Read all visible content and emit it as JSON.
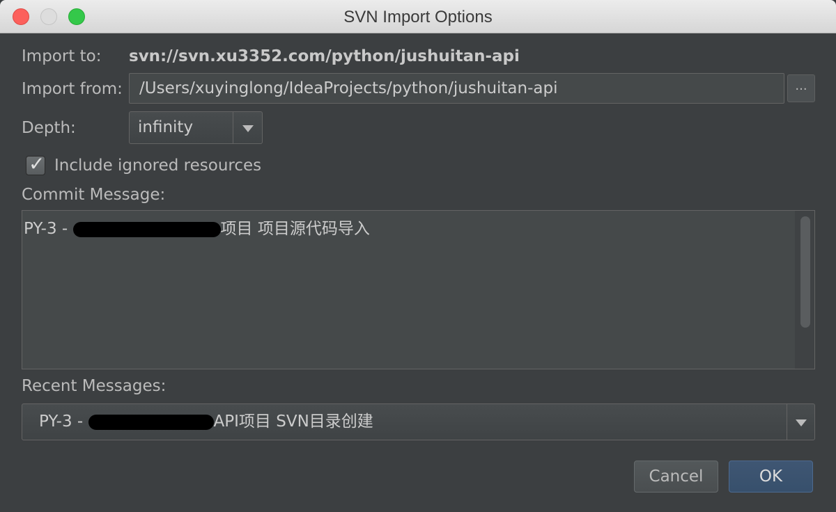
{
  "window": {
    "title": "SVN Import Options"
  },
  "import_to": {
    "label": "Import to:",
    "value": "svn://svn.xu3352.com/python/jushuitan-api"
  },
  "import_from": {
    "label": "Import from:",
    "value": "/Users/xuyinglong/IdeaProjects/python/jushuitan-api",
    "browse_label": "..."
  },
  "depth": {
    "label": "Depth:",
    "selected": "infinity"
  },
  "include_ignored": {
    "label": "Include ignored resources",
    "checked": true
  },
  "commit_message": {
    "label": "Commit Message:",
    "value_prefix": "PY-3 - ",
    "value_suffix": "项目 项目源代码导入"
  },
  "recent_messages": {
    "label": "Recent Messages:",
    "selected_prefix": "PY-3 - ",
    "selected_suffix": "API项目 SVN目录创建"
  },
  "buttons": {
    "cancel": "Cancel",
    "ok": "OK"
  },
  "colors": {
    "background": "#3c3f41",
    "ok_button": "#3f5673",
    "close": "#fc605c",
    "maximize": "#34c84a"
  }
}
